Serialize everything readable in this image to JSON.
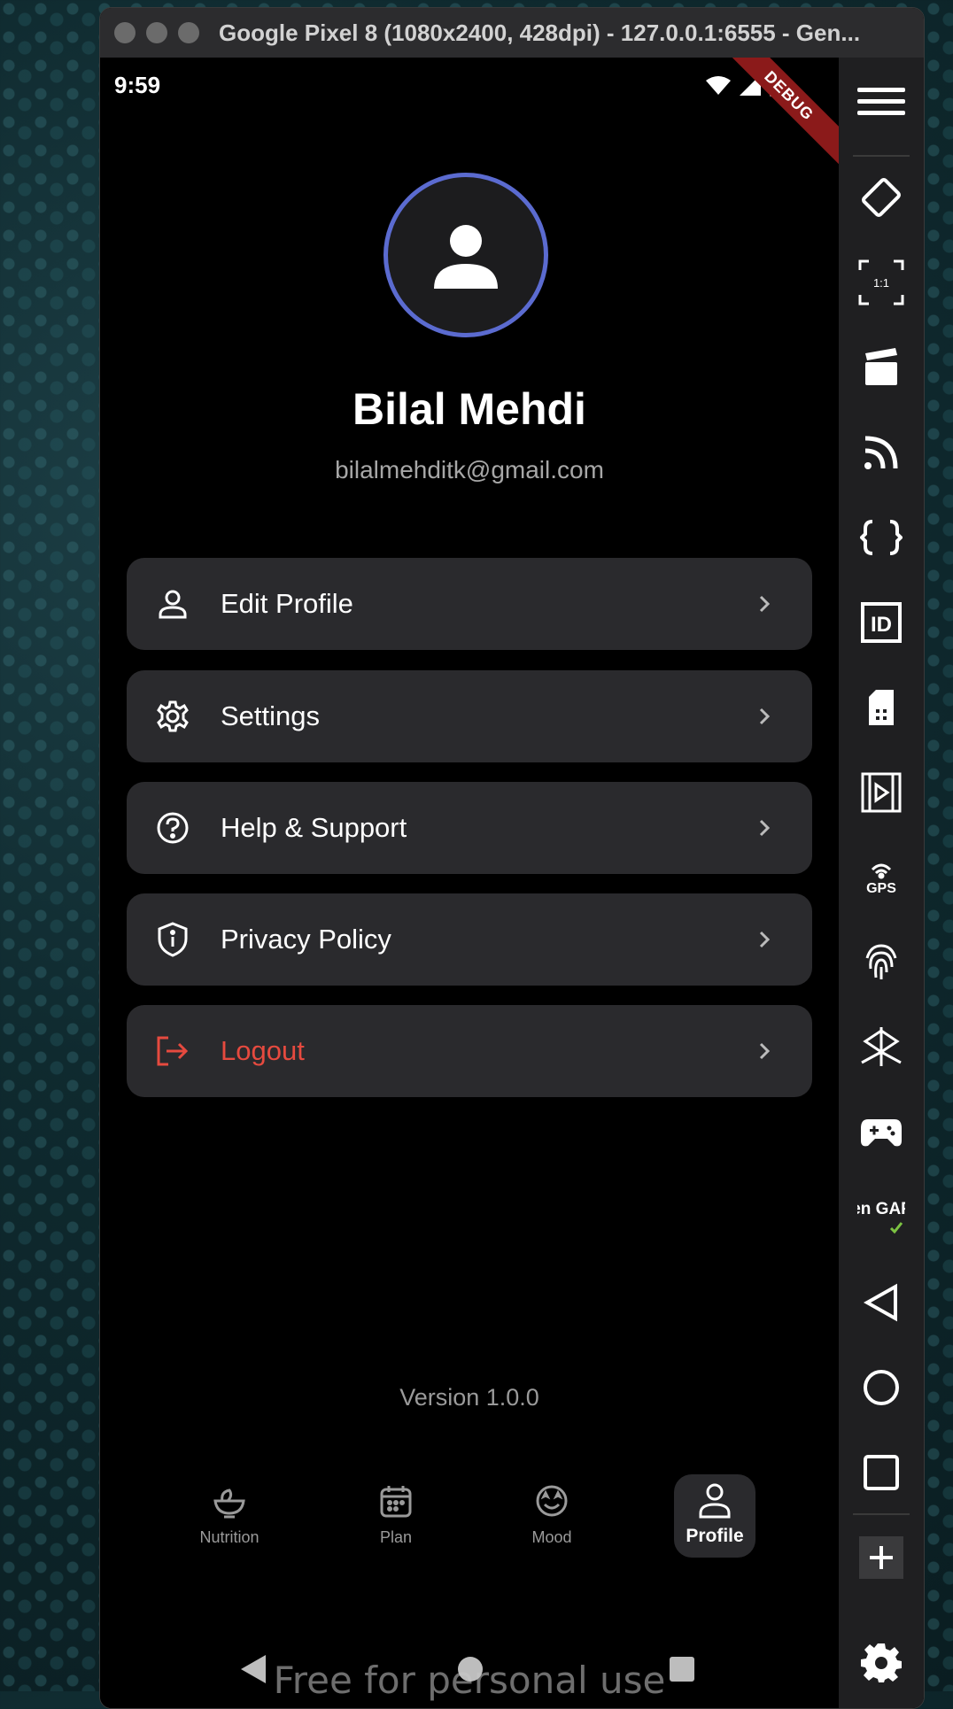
{
  "window": {
    "title": "Google Pixel 8 (1080x2400, 428dpi) - 127.0.0.1:6555 - Gen..."
  },
  "status_bar": {
    "time": "9:59",
    "debug_label": "DEBUG"
  },
  "profile": {
    "name": "Bilal Mehdi",
    "email": "bilalmehditk@gmail.com"
  },
  "menu": [
    {
      "label": "Edit Profile",
      "icon": "person-icon"
    },
    {
      "label": "Settings",
      "icon": "gear-icon"
    },
    {
      "label": "Help & Support",
      "icon": "help-icon"
    },
    {
      "label": "Privacy Policy",
      "icon": "shield-icon"
    },
    {
      "label": "Logout",
      "icon": "logout-icon"
    }
  ],
  "version": "Version 1.0.0",
  "bottom_nav": [
    {
      "label": "Nutrition",
      "icon": "bowl-icon",
      "active": false
    },
    {
      "label": "Plan",
      "icon": "calendar-icon",
      "active": false
    },
    {
      "label": "Mood",
      "icon": "mood-face-icon",
      "active": false
    },
    {
      "label": "Profile",
      "icon": "person-icon",
      "active": true
    }
  ],
  "watermark": "Free for personal use",
  "sidebar": {
    "icons": [
      "menu-icon",
      "rotate-icon",
      "pixel-perfect-icon",
      "capture-icon",
      "rss-icon",
      "braces-icon",
      "id-icon",
      "sim-icon",
      "media-icon",
      "gps-icon",
      "fingerprint-icon",
      "sensor-icon",
      "gamepad-icon",
      "opengapps-icon",
      "back-icon",
      "home-icon",
      "overview-icon",
      "add-icon",
      "settings-icon"
    ],
    "pixel_perfect_label": "1:1",
    "gps_label": "GPS",
    "opengapps_label": "Open GAPPS",
    "id_label": "ID"
  },
  "colors": {
    "accent": "#5b6bd0",
    "danger": "#e64a3f",
    "card": "#2a2a2d",
    "ribbon": "#8b1a1a"
  }
}
